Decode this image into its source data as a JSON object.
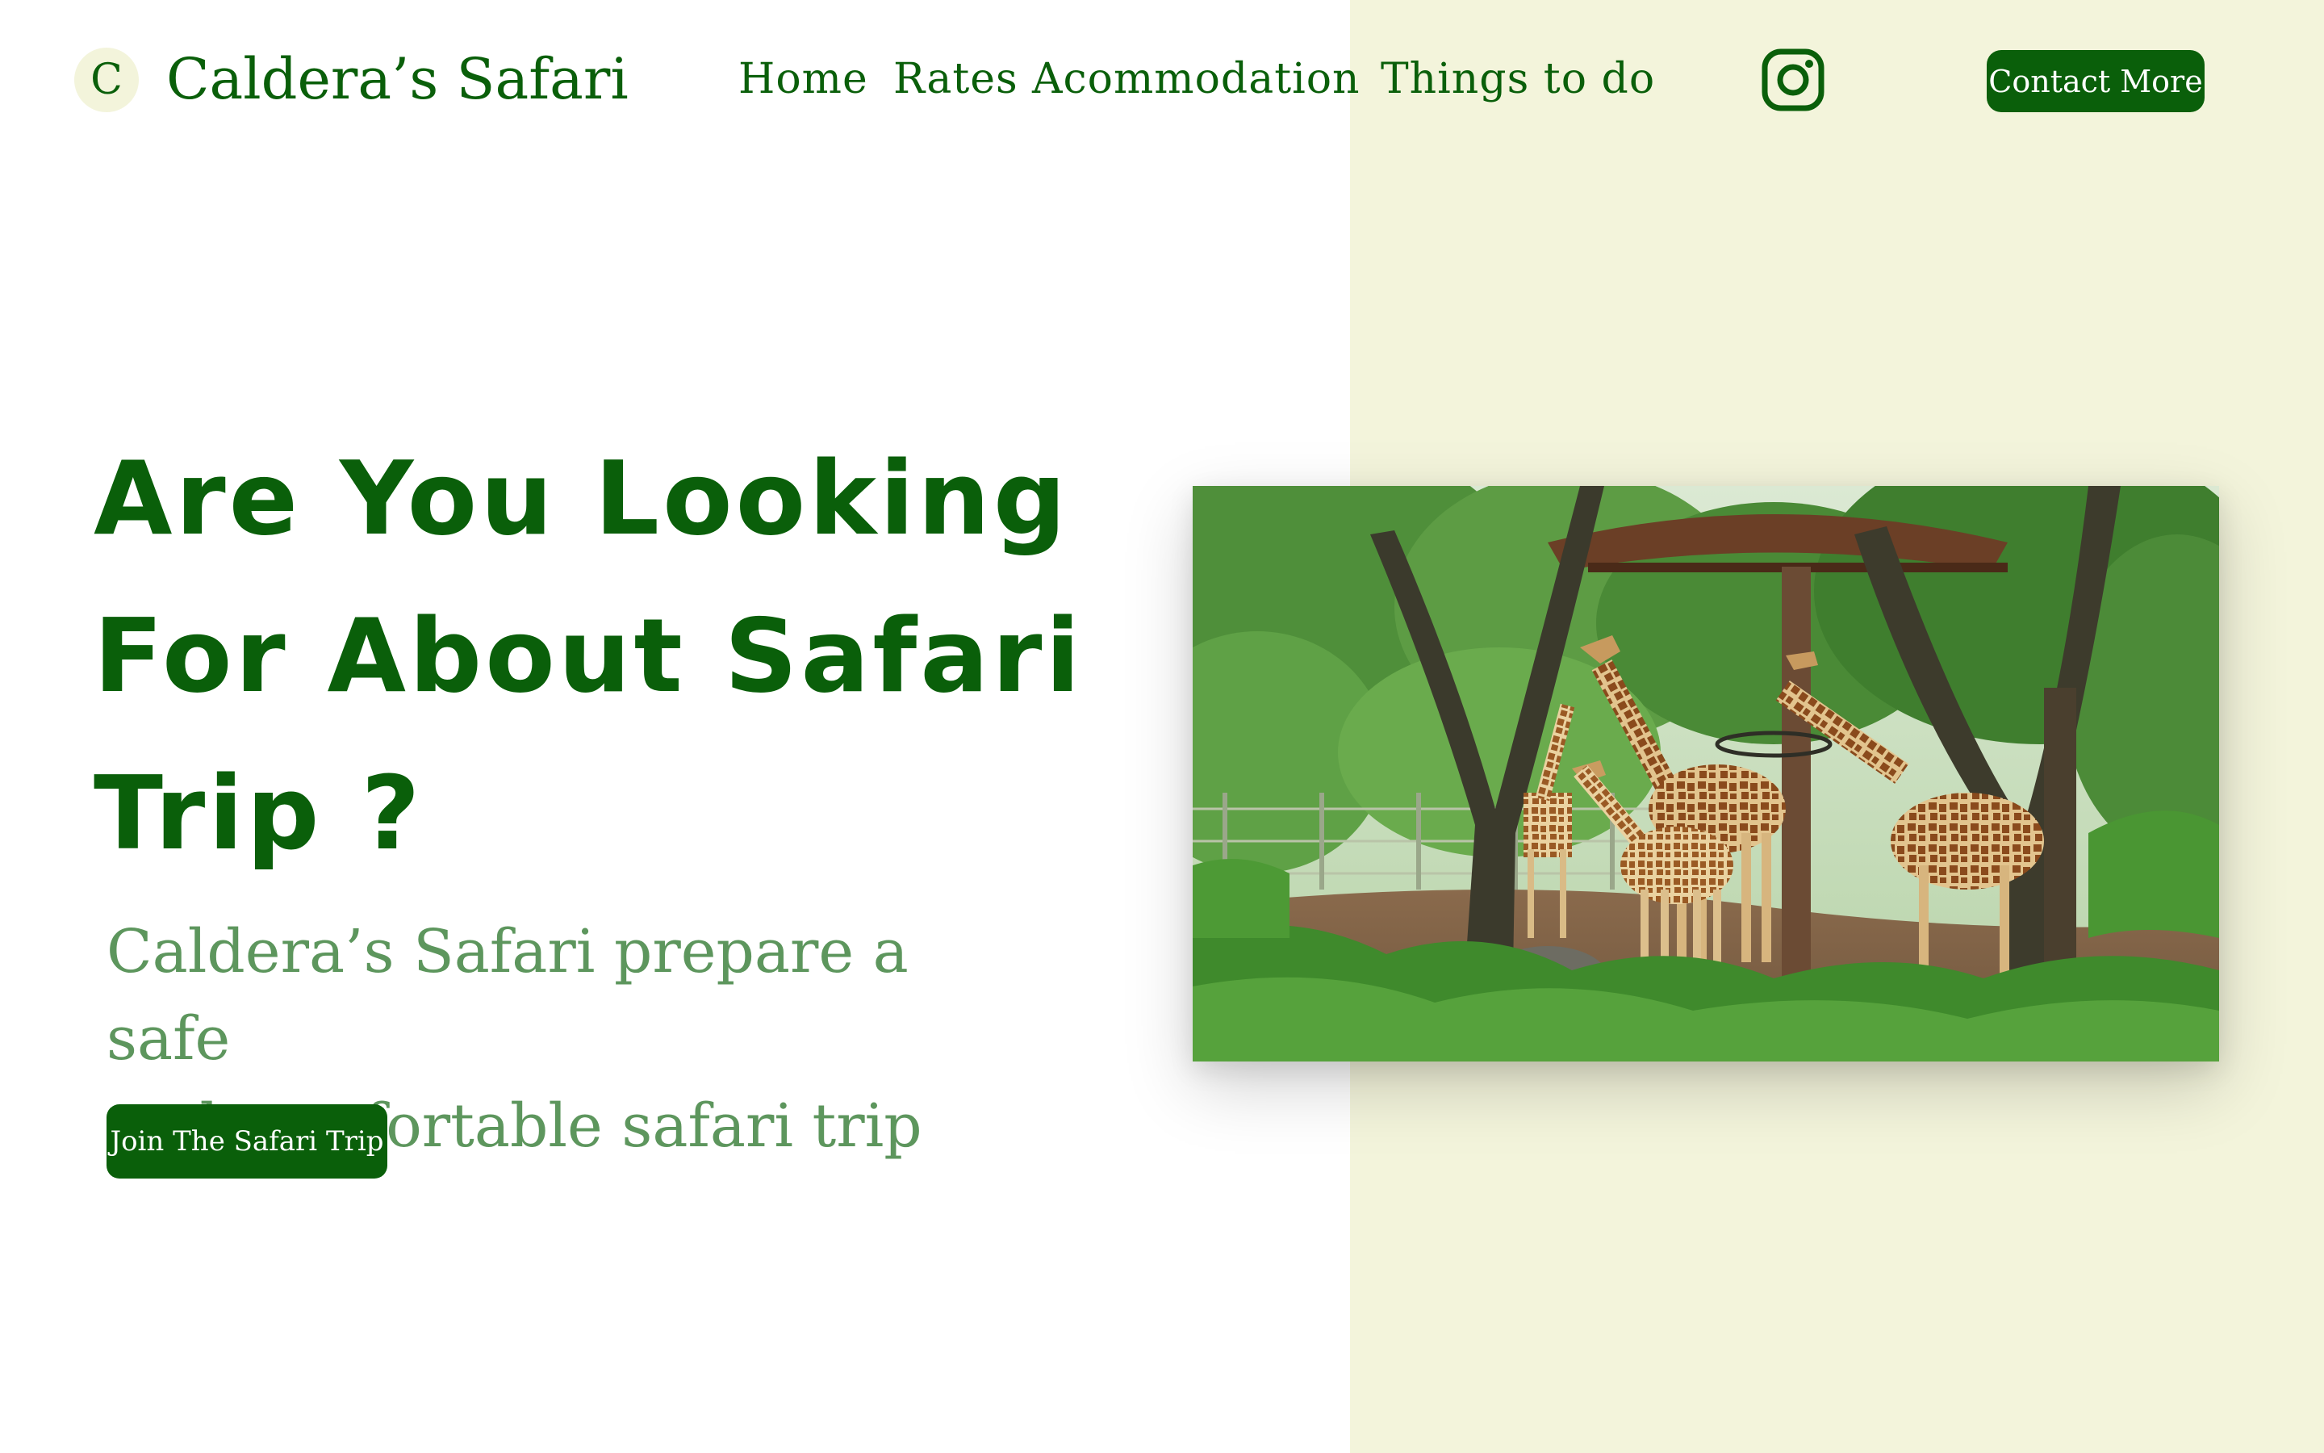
{
  "brand": {
    "logo_letter": "C",
    "name": "Caldera’s Safari"
  },
  "nav": {
    "home": "Home",
    "rates": "Rates",
    "accommodation": "Acommodation",
    "things_to_do": "Things to do"
  },
  "social": {
    "icon": "instagram-icon"
  },
  "header": {
    "contact_label": "Contact More"
  },
  "hero": {
    "title_line_1": "Are You Looking",
    "title_line_2": "For About Safari",
    "title_line_3": "Trip ?",
    "subtitle_line_1": "Caldera’s Safari prepare a safe",
    "subtitle_line_2": "and comfortable safari trip",
    "cta_label": "Join The Safari Trip"
  },
  "image": {
    "subject": "giraffes"
  },
  "colors": {
    "primary": "#0a5f0a",
    "panel": "#f3f4db",
    "subtitle": "#5d965d",
    "button_text": "#ffffff"
  }
}
